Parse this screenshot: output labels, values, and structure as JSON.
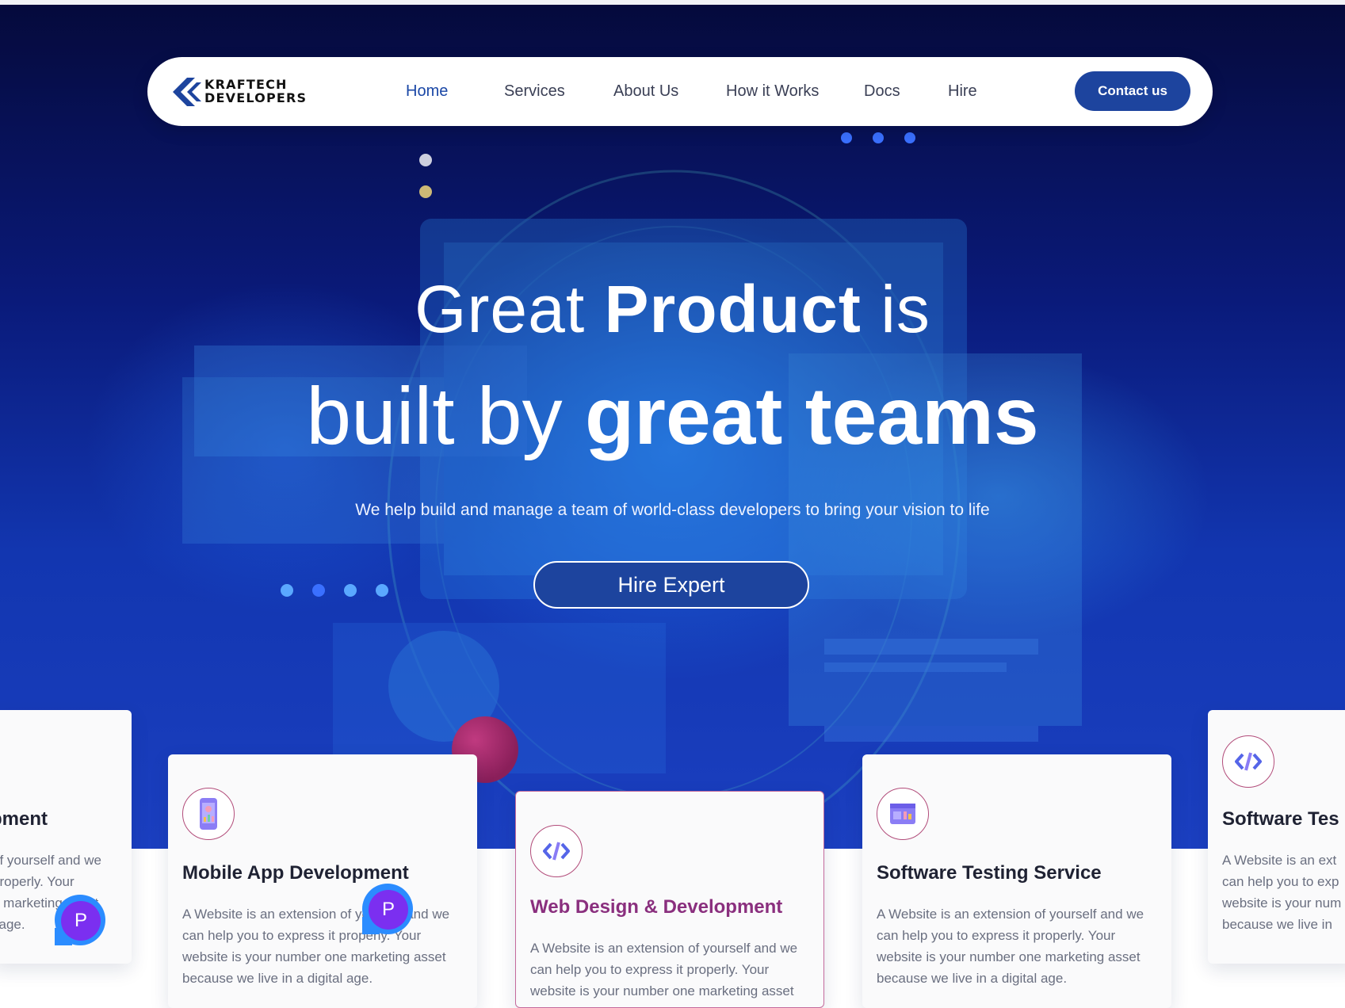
{
  "brand": {
    "line1": "KRAFTECH",
    "line2": "DEVELOPERS"
  },
  "signature": "",
  "nav": {
    "items": [
      {
        "label": "Home",
        "active": true
      },
      {
        "label": "Services"
      },
      {
        "label": "About Us"
      },
      {
        "label": "How it Works"
      },
      {
        "label": "Docs"
      },
      {
        "label": "Hire"
      }
    ],
    "contact_label": "Contact us"
  },
  "hero": {
    "line1_a": "Great ",
    "line1_b": "Product",
    "line1_c": " is",
    "line2_a": "built by ",
    "line2_b": "great teams",
    "subtitle": "We help build and manage a team of world-class developers to bring your vision to life",
    "cta_label": "Hire Expert"
  },
  "cards": [
    {
      "title": "pment",
      "desc_lines": [
        "of yourself and we",
        "properly. Your",
        "e marketing asset",
        "l age."
      ]
    },
    {
      "title": "Mobile App Development",
      "desc": "A Website is an extension of yourself and we can help you to express it properly. Your website is your number one marketing asset because we live in a digital age."
    },
    {
      "title": "Web Design & Development",
      "desc": "A Website is an extension of yourself and we can help you to express it properly. Your website is your number one marketing asset because we live in a digital age."
    },
    {
      "title": "Software Testing Service",
      "desc": "A Website is an extension of yourself and we can help you to express it properly. Your website is your number one marketing asset because we live in a digital age."
    },
    {
      "title": "Software Tes",
      "desc_lines": [
        "A Website is an ext",
        "can help you to exp",
        "website is your num",
        "because we live in"
      ]
    }
  ],
  "chat_widget": {
    "letter": "P"
  },
  "colors": {
    "brand_blue": "#1d449e",
    "accent_magenta": "#8a2f7e",
    "hero_dark": "#050a3c"
  }
}
